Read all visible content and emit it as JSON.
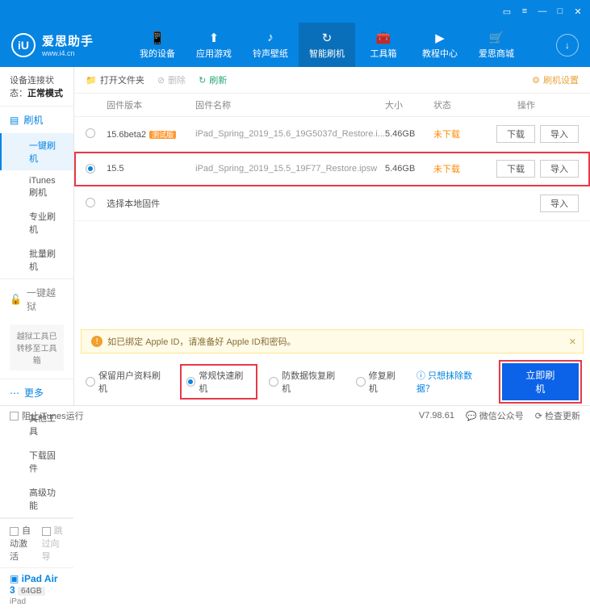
{
  "titlebar": {
    "icons": [
      "menu",
      "min",
      "max",
      "close"
    ]
  },
  "header": {
    "logo_letter": "iU",
    "logo_text": "爱思助手",
    "logo_url": "www.i4.cn",
    "nav": [
      {
        "label": "我的设备",
        "icon": "📱"
      },
      {
        "label": "应用游戏",
        "icon": "⬆"
      },
      {
        "label": "铃声壁纸",
        "icon": "♪"
      },
      {
        "label": "智能刷机",
        "icon": "↻",
        "active": true
      },
      {
        "label": "工具箱",
        "icon": "🧰"
      },
      {
        "label": "教程中心",
        "icon": "▶"
      },
      {
        "label": "爱思商城",
        "icon": "🛒"
      }
    ]
  },
  "sidebar": {
    "conn_label": "设备连接状态：",
    "conn_value": "正常模式",
    "groups": [
      {
        "head": "刷机",
        "icon": "▤",
        "items": [
          "一键刷机",
          "iTunes刷机",
          "专业刷机",
          "批量刷机"
        ],
        "active_index": 0
      },
      {
        "head": "一键越狱",
        "icon": "🔓",
        "gray": true,
        "note": "越狱工具已转移至工具箱"
      },
      {
        "head": "更多",
        "icon": "⋯",
        "items": [
          "其他工具",
          "下载固件",
          "高级功能"
        ]
      }
    ],
    "bottom": {
      "auto_activate": "自动激活",
      "skip_guide": "跳过向导"
    },
    "device": {
      "name": "iPad Air 3",
      "capacity": "64GB",
      "type": "iPad"
    }
  },
  "toolbar": {
    "open_folder": "打开文件夹",
    "delete": "删除",
    "refresh": "刷新",
    "settings": "刷机设置"
  },
  "table": {
    "headers": {
      "version": "固件版本",
      "name": "固件名称",
      "size": "大小",
      "status": "状态",
      "ops": "操作"
    },
    "rows": [
      {
        "version": "15.6beta2",
        "badge": "测试版",
        "name": "iPad_Spring_2019_15.6_19G5037d_Restore.i...",
        "size": "5.46GB",
        "status": "未下载",
        "selected": false
      },
      {
        "version": "15.5",
        "badge": "",
        "name": "iPad_Spring_2019_15.5_19F77_Restore.ipsw",
        "size": "5.46GB",
        "status": "未下载",
        "selected": true
      }
    ],
    "local_row": "选择本地固件",
    "btn_download": "下载",
    "btn_import": "导入"
  },
  "warn": {
    "text": "如已绑定 Apple ID，请准备好 Apple ID和密码。"
  },
  "modes": {
    "opts": [
      "保留用户资料刷机",
      "常规快速刷机",
      "防数据恢复刷机",
      "修复刷机"
    ],
    "selected_index": 1,
    "help": "只想抹除数据？",
    "primary": "立即刷机"
  },
  "statusbar": {
    "block_itunes": "阻止iTunes运行",
    "version": "V7.98.61",
    "wechat": "微信公众号",
    "check_update": "检查更新"
  }
}
